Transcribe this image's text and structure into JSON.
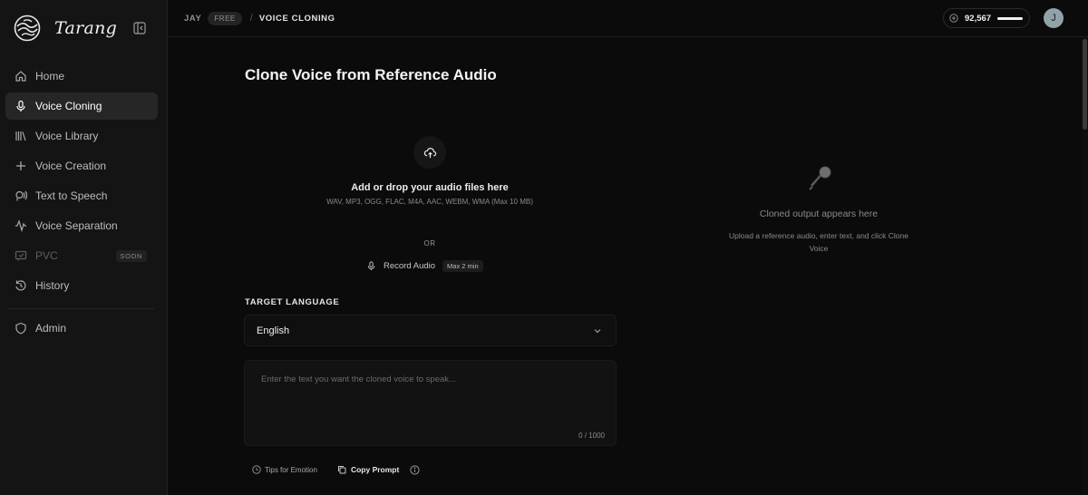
{
  "brand": {
    "name": "Tarang"
  },
  "sidebar": {
    "items": [
      {
        "label": "Home",
        "icon": "home-icon"
      },
      {
        "label": "Voice Cloning",
        "icon": "mic-icon",
        "active": true
      },
      {
        "label": "Voice Library",
        "icon": "library-icon"
      },
      {
        "label": "Voice Creation",
        "icon": "plus-icon"
      },
      {
        "label": "Text to Speech",
        "icon": "speech-icon"
      },
      {
        "label": "Voice Separation",
        "icon": "waveform-icon"
      },
      {
        "label": "PVC",
        "icon": "pvc-icon",
        "disabled": true,
        "badge": "SOON"
      },
      {
        "label": "History",
        "icon": "history-icon"
      }
    ],
    "admin": {
      "label": "Admin",
      "icon": "shield-icon"
    }
  },
  "topbar": {
    "user": "JAY",
    "plan": "FREE",
    "separator": "/",
    "page": "VOICE CLONING",
    "credits": "92,567",
    "credits_level": 1.0,
    "avatar_initial": "J"
  },
  "main": {
    "title": "Clone Voice from Reference Audio",
    "upload": {
      "title": "Add or drop your audio files here",
      "formats": "WAV, MP3, OGG, FLAC, M4A, AAC, WEBM, WMA (Max 10 MB)"
    },
    "or": "OR",
    "record": {
      "label": "Record Audio",
      "max": "Max 2 min"
    },
    "language": {
      "label": "TARGET LANGUAGE",
      "value": "English"
    },
    "text": {
      "placeholder": "Enter the text you want the cloned voice to speak...",
      "count": "0 / 1000"
    },
    "actions": {
      "tips": "Tips for Emotion",
      "copy": "Copy Prompt"
    }
  },
  "output": {
    "title": "Cloned output appears here",
    "description": "Upload a reference audio, enter text, and click Clone Voice"
  },
  "colors": {
    "background": "#0b0b0b",
    "sidebar": "#141414",
    "active_item": "#262626",
    "text_primary": "#f5f5f5",
    "text_muted": "#8a8a8a"
  }
}
